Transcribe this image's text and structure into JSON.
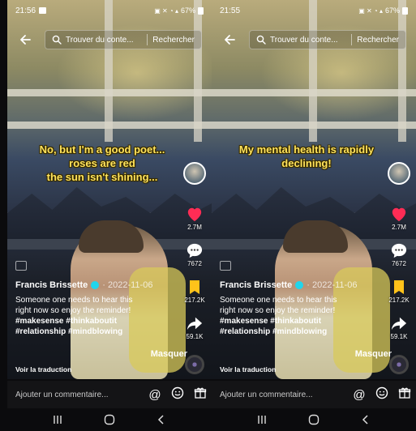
{
  "panels": [
    {
      "status": {
        "time": "21:56",
        "battery": "67%"
      },
      "search": {
        "placeholder": "Trouver du conte...",
        "button": "Rechercher"
      },
      "caption": {
        "lines": [
          "No, but I'm a good poet...",
          "roses are red",
          "the sun isn't shining..."
        ]
      },
      "rail": {
        "likes": "2.7M",
        "comments": "7672",
        "saves": "217.2K",
        "shares": "59.1K"
      },
      "post": {
        "author": "Francis Brissette",
        "date": "· 2022-11-06",
        "description_lines": [
          "Someone one needs to hear this",
          "right now so enjoy the reminder!"
        ],
        "hashtag_lines": [
          "#makesense #thinkaboutit",
          "#relationship #mindblowing"
        ],
        "hide": "Masquer",
        "translate": "Voir la traduction"
      },
      "comment": {
        "placeholder": "Ajouter un commentaire..."
      }
    },
    {
      "status": {
        "time": "21:55",
        "battery": "67%"
      },
      "search": {
        "placeholder": "Trouver du conte...",
        "button": "Rechercher"
      },
      "caption": {
        "lines": [
          "My mental health is rapidly",
          "declining!"
        ]
      },
      "rail": {
        "likes": "2.7M",
        "comments": "7672",
        "saves": "217.2K",
        "shares": "59.1K"
      },
      "post": {
        "author": "Francis Brissette",
        "date": "· 2022-11-06",
        "description_lines": [
          "Someone one needs to hear this",
          "right now so enjoy the reminder!"
        ],
        "hashtag_lines": [
          "#makesense #thinkaboutit",
          "#relationship #mindblowing"
        ],
        "hide": "Masquer",
        "translate": "Voir la traduction"
      },
      "comment": {
        "placeholder": "Ajouter un commentaire..."
      }
    }
  ],
  "colors": {
    "caption": "#ffe35c",
    "like": "#fe2c55",
    "bookmark": "#ffc21a",
    "verified": "#20d5ec"
  },
  "icons": [
    "back-arrow-icon",
    "search-icon",
    "heart-icon",
    "comment-icon",
    "bookmark-icon",
    "share-icon",
    "mention-icon",
    "emoji-icon",
    "gift-icon",
    "recents-icon",
    "home-icon",
    "back-nav-icon"
  ]
}
